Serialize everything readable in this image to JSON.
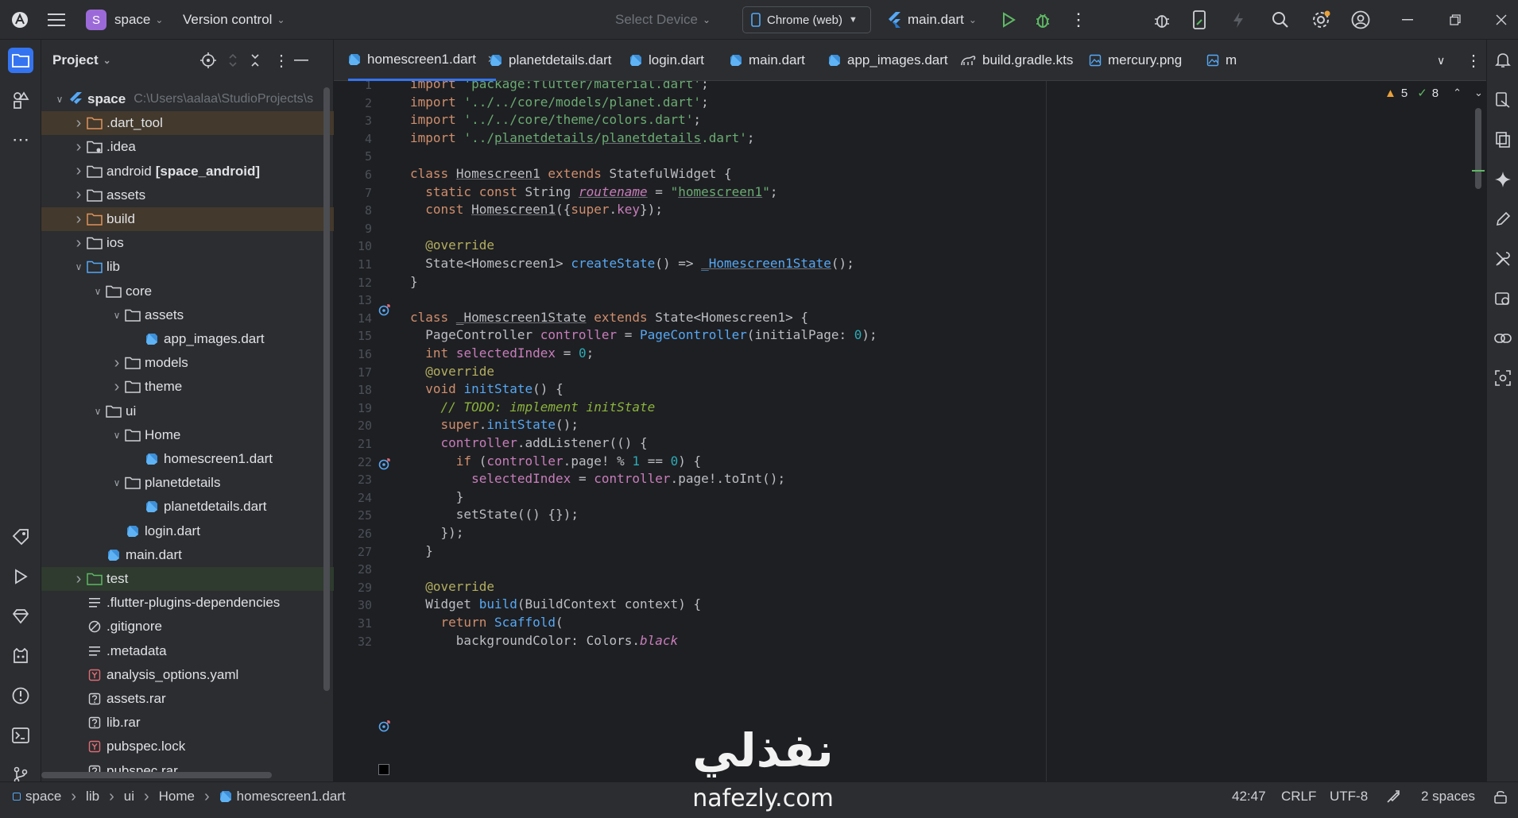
{
  "titlebar": {
    "project_initial": "S",
    "project_name": "space",
    "vcs_label": "Version control",
    "device_label": "Select Device",
    "browser_label": "Chrome (web)",
    "run_config": "main.dart"
  },
  "project_panel": {
    "title": "Project",
    "tree": [
      {
        "label": "space",
        "suffix": "C:\\Users\\aalaa\\StudioProjects\\s",
        "icon": "flutter-module-icon",
        "arrow": "down",
        "indent": 0,
        "bold": true
      },
      {
        "label": ".dart_tool",
        "icon": "folder-excluded-icon",
        "arrow": "right",
        "indent": 1,
        "hl": "orange"
      },
      {
        "label": ".idea",
        "icon": "folder-settings-icon",
        "arrow": "right",
        "indent": 1
      },
      {
        "label": "android",
        "bold_suffix": "[space_android]",
        "icon": "folder-icon",
        "arrow": "right",
        "indent": 1
      },
      {
        "label": "assets",
        "icon": "folder-icon",
        "arrow": "right",
        "indent": 1
      },
      {
        "label": "build",
        "icon": "folder-excluded-icon",
        "arrow": "right",
        "indent": 1,
        "hl": "orange"
      },
      {
        "label": "ios",
        "icon": "folder-icon",
        "arrow": "right",
        "indent": 1
      },
      {
        "label": "lib",
        "icon": "folder-source-icon",
        "arrow": "down",
        "indent": 1
      },
      {
        "label": "core",
        "icon": "folder-icon",
        "arrow": "down",
        "indent": 2
      },
      {
        "label": "assets",
        "icon": "folder-icon",
        "arrow": "down",
        "indent": 3
      },
      {
        "label": "app_images.dart",
        "icon": "dart-file-icon",
        "arrow": "",
        "indent": 4
      },
      {
        "label": "models",
        "icon": "folder-icon",
        "arrow": "right",
        "indent": 3
      },
      {
        "label": "theme",
        "icon": "folder-icon",
        "arrow": "right",
        "indent": 3
      },
      {
        "label": "ui",
        "icon": "folder-icon",
        "arrow": "down",
        "indent": 2
      },
      {
        "label": "Home",
        "icon": "folder-icon",
        "arrow": "down",
        "indent": 3
      },
      {
        "label": "homescreen1.dart",
        "icon": "dart-file-icon",
        "arrow": "",
        "indent": 4
      },
      {
        "label": "planetdetails",
        "icon": "folder-icon",
        "arrow": "down",
        "indent": 3
      },
      {
        "label": "planetdetails.dart",
        "icon": "dart-file-icon",
        "arrow": "",
        "indent": 4
      },
      {
        "label": "login.dart",
        "icon": "dart-file-icon",
        "arrow": "",
        "indent": 3
      },
      {
        "label": "main.dart",
        "icon": "dart-file-icon",
        "arrow": "",
        "indent": 2
      },
      {
        "label": "test",
        "icon": "folder-test-icon",
        "arrow": "right",
        "indent": 1,
        "hl": "green"
      },
      {
        "label": ".flutter-plugins-dependencies",
        "icon": "text-file-icon",
        "arrow": "",
        "indent": 1
      },
      {
        "label": ".gitignore",
        "icon": "ignore-file-icon",
        "arrow": "",
        "indent": 1
      },
      {
        "label": ".metadata",
        "icon": "text-file-icon",
        "arrow": "",
        "indent": 1
      },
      {
        "label": "analysis_options.yaml",
        "icon": "yaml-file-icon",
        "arrow": "",
        "indent": 1
      },
      {
        "label": "assets.rar",
        "icon": "unknown-file-icon",
        "arrow": "",
        "indent": 1
      },
      {
        "label": "lib.rar",
        "icon": "unknown-file-icon",
        "arrow": "",
        "indent": 1
      },
      {
        "label": "pubspec.lock",
        "icon": "yaml-file-icon",
        "arrow": "",
        "indent": 1
      },
      {
        "label": "pubspec.rar",
        "icon": "unknown-file-icon",
        "arrow": "",
        "indent": 1
      }
    ]
  },
  "tabs": [
    {
      "label": "homescreen1.dart",
      "icon": "dart-file-icon",
      "active": true
    },
    {
      "label": "planetdetails.dart",
      "icon": "dart-file-icon"
    },
    {
      "label": "login.dart",
      "icon": "dart-file-icon"
    },
    {
      "label": "main.dart",
      "icon": "dart-file-icon"
    },
    {
      "label": "app_images.dart",
      "icon": "dart-file-icon"
    },
    {
      "label": "build.gradle.kts",
      "icon": "gradle-file-icon"
    },
    {
      "label": "mercury.png",
      "icon": "image-file-icon"
    },
    {
      "label": "m",
      "icon": "image-file-icon"
    }
  ],
  "inspections": {
    "warnings": "5",
    "weak_warnings": "8"
  },
  "code_lines": [
    {
      "n": "1",
      "t": "import 'package:flutter/material.dart';"
    },
    {
      "n": "2",
      "t": "import '../../core/models/planet.dart';"
    },
    {
      "n": "3",
      "t": "import '../../core/theme/colors.dart';"
    },
    {
      "n": "4",
      "t": "import '../planetdetails/planetdetails.dart';"
    },
    {
      "n": "5",
      "t": ""
    },
    {
      "n": "6",
      "t": "class Homescreen1 extends StatefulWidget {"
    },
    {
      "n": "7",
      "t": "  static const String routename = \"homescreen1\";"
    },
    {
      "n": "8",
      "t": "  const Homescreen1({super.key});"
    },
    {
      "n": "9",
      "t": ""
    },
    {
      "n": "10",
      "t": "  @override"
    },
    {
      "n": "11",
      "t": "  State<Homescreen1> createState() => _Homescreen1State();"
    },
    {
      "n": "12",
      "t": "}"
    },
    {
      "n": "13",
      "t": ""
    },
    {
      "n": "14",
      "t": "class _Homescreen1State extends State<Homescreen1> {"
    },
    {
      "n": "15",
      "t": "  PageController controller = PageController(initialPage: 0);"
    },
    {
      "n": "16",
      "t": "  int selectedIndex = 0;"
    },
    {
      "n": "17",
      "t": "  @override"
    },
    {
      "n": "18",
      "t": "  void initState() {"
    },
    {
      "n": "19",
      "t": "    // TODO: implement initState"
    },
    {
      "n": "20",
      "t": "    super.initState();"
    },
    {
      "n": "21",
      "t": "    controller.addListener(() {"
    },
    {
      "n": "22",
      "t": "      if (controller.page! % 1 == 0) {"
    },
    {
      "n": "23",
      "t": "        selectedIndex = controller.page!.toInt();"
    },
    {
      "n": "24",
      "t": "      }"
    },
    {
      "n": "25",
      "t": "      setState(() {});"
    },
    {
      "n": "26",
      "t": "    });"
    },
    {
      "n": "27",
      "t": "  }"
    },
    {
      "n": "28",
      "t": ""
    },
    {
      "n": "29",
      "t": "  @override"
    },
    {
      "n": "30",
      "t": "  Widget build(BuildContext context) {"
    },
    {
      "n": "31",
      "t": "    return Scaffold("
    },
    {
      "n": "32",
      "t": "      backgroundColor: Colors.black"
    }
  ],
  "breadcrumb": [
    "space",
    "lib",
    "ui",
    "Home",
    "homescreen1.dart"
  ],
  "status": {
    "position": "42:47",
    "line_sep": "CRLF",
    "encoding": "UTF-8",
    "indent": "2 spaces"
  },
  "watermark": {
    "arabic": "نفذلي",
    "latin": "nafezly.com"
  },
  "colors": {
    "accent": "#3574f0",
    "bg": "#1e1f22",
    "panel": "#2b2d30"
  }
}
